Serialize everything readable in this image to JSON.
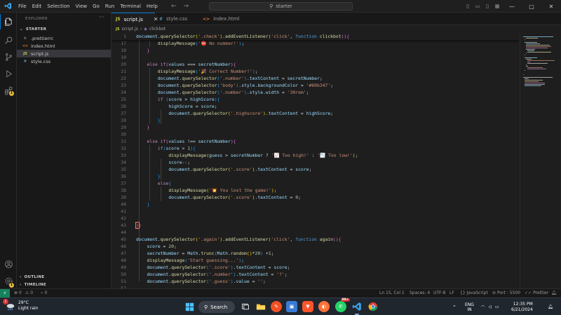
{
  "window": {
    "menu": [
      "File",
      "Edit",
      "Selection",
      "View",
      "Go",
      "Run",
      "Terminal",
      "Help"
    ],
    "search_text": "starter",
    "colors": {
      "accent": "#0078d4",
      "bg": "#1e1e1e",
      "sidebar": "#181818"
    }
  },
  "sidebar": {
    "title": "EXPLORER",
    "folder": "STARTER",
    "files": [
      {
        "name": ".prettierrc",
        "icon": "gear-icon"
      },
      {
        "name": "index.html",
        "icon": "html-file-icon"
      },
      {
        "name": "script.js",
        "icon": "js-file-icon",
        "selected": true
      },
      {
        "name": "style.css",
        "icon": "css-file-icon"
      }
    ],
    "outline": "OUTLINE",
    "timeline": "TIMELINE"
  },
  "tabs": [
    {
      "label": "script.js",
      "icon": "JS",
      "active": true
    },
    {
      "label": "style.css",
      "icon": "#",
      "active": false
    },
    {
      "label": "index.html",
      "icon": "<>",
      "active": false
    }
  ],
  "breadcrumb": {
    "file": "script.js",
    "symbol": "clickbot"
  },
  "code": {
    "sticky": {
      "number": "1",
      "text": "document.querySelector('.check').addEventListener('click', function clickbot(){"
    },
    "lines": [
      {
        "n": "17",
        "t": "        displayMessage('⛔ No number!');"
      },
      {
        "n": "18",
        "t": "    }"
      },
      {
        "n": "19",
        "t": ""
      },
      {
        "n": "20",
        "t": "    else if(values === secretNumber){"
      },
      {
        "n": "21",
        "t": "        displayMessage('🎉 Correct Number!');"
      },
      {
        "n": "22",
        "t": "        document.querySelector('.number').textContent = secretNumber;"
      },
      {
        "n": "23",
        "t": "        document.querySelector('body').style.backgroundColor = '#60b347';"
      },
      {
        "n": "24",
        "t": "        document.querySelector('.number').style.width = '30rem';"
      },
      {
        "n": "25",
        "t": "        if (score > highScore){"
      },
      {
        "n": "26",
        "t": "            highScore = score;"
      },
      {
        "n": "27",
        "t": "            document.querySelector('.highscore').textContent = highScore;"
      },
      {
        "n": "28",
        "t": "        }"
      },
      {
        "n": "29",
        "t": "    }"
      },
      {
        "n": "30",
        "t": ""
      },
      {
        "n": "31",
        "t": "    else if(values !== secretNumber){"
      },
      {
        "n": "32",
        "t": "        if(score > 1){"
      },
      {
        "n": "33",
        "t": "            displayMessage(guess > secretNumber ? '📈 Too high!' : '📉 Too low!');"
      },
      {
        "n": "34",
        "t": "            score--;"
      },
      {
        "n": "35",
        "t": "            document.querySelector('.score').textContent = score;"
      },
      {
        "n": "36",
        "t": "        }"
      },
      {
        "n": "37",
        "t": "        else{"
      },
      {
        "n": "38",
        "t": "            displayMessage('💥 You lost the game!');"
      },
      {
        "n": "39",
        "t": "            document.querySelector('.score').textContent = 0;"
      },
      {
        "n": "40",
        "t": "    }"
      },
      {
        "n": "41",
        "t": ""
      },
      {
        "n": "42",
        "t": ""
      },
      {
        "n": "43",
        "t": "})"
      },
      {
        "n": "44",
        "t": ""
      },
      {
        "n": "45",
        "t": "document.querySelector('.again').addEventListener('click', function again(){"
      },
      {
        "n": "46",
        "t": "    score = 20;"
      },
      {
        "n": "47",
        "t": "    secretNumber = Math.trunc(Math.random()*20) +1;"
      },
      {
        "n": "48",
        "t": "    displayMessage('Start guessing...');"
      },
      {
        "n": "49",
        "t": "    document.querySelector('.score').textContent = score;"
      },
      {
        "n": "50",
        "t": "    document.querySelector('.number').textContent = '?';"
      },
      {
        "n": "51",
        "t": "    document.querySelector('.guess').value = '';"
      },
      {
        "n": "52",
        "t": ""
      }
    ]
  },
  "statusbar": {
    "problems_errors": "0",
    "problems_warnings": "0",
    "ports": "0",
    "cursor": "Ln 15, Col 1",
    "spaces": "Spaces: 4",
    "encoding": "UTF-8",
    "eol": "LF",
    "language": "JavaScript",
    "port": "Port : 5500",
    "prettier": "Prettier"
  },
  "taskbar": {
    "weather_temp": "29°C",
    "weather_desc": "Light rain",
    "search_label": "Search",
    "lang_top": "ENG",
    "lang_bottom": "IN",
    "time": "12:35 PM",
    "date": "6/21/2024",
    "notification_count": "99+"
  }
}
